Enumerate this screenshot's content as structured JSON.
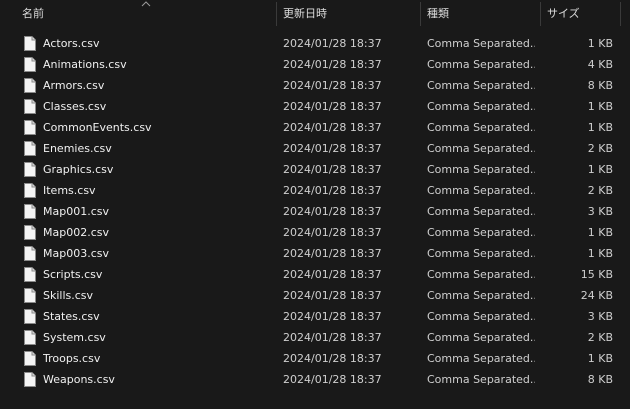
{
  "columns": {
    "name": "名前",
    "date": "更新日時",
    "type": "種類",
    "size": "サイズ"
  },
  "sort": {
    "column": "name",
    "direction": "ascending"
  },
  "files": [
    {
      "name": "Actors.csv",
      "date": "2024/01/28 18:37",
      "type": "Comma Separated...",
      "size": "1 KB"
    },
    {
      "name": "Animations.csv",
      "date": "2024/01/28 18:37",
      "type": "Comma Separated...",
      "size": "4 KB"
    },
    {
      "name": "Armors.csv",
      "date": "2024/01/28 18:37",
      "type": "Comma Separated...",
      "size": "8 KB"
    },
    {
      "name": "Classes.csv",
      "date": "2024/01/28 18:37",
      "type": "Comma Separated...",
      "size": "1 KB"
    },
    {
      "name": "CommonEvents.csv",
      "date": "2024/01/28 18:37",
      "type": "Comma Separated...",
      "size": "1 KB"
    },
    {
      "name": "Enemies.csv",
      "date": "2024/01/28 18:37",
      "type": "Comma Separated...",
      "size": "2 KB"
    },
    {
      "name": "Graphics.csv",
      "date": "2024/01/28 18:37",
      "type": "Comma Separated...",
      "size": "1 KB"
    },
    {
      "name": "Items.csv",
      "date": "2024/01/28 18:37",
      "type": "Comma Separated...",
      "size": "2 KB"
    },
    {
      "name": "Map001.csv",
      "date": "2024/01/28 18:37",
      "type": "Comma Separated...",
      "size": "3 KB"
    },
    {
      "name": "Map002.csv",
      "date": "2024/01/28 18:37",
      "type": "Comma Separated...",
      "size": "1 KB"
    },
    {
      "name": "Map003.csv",
      "date": "2024/01/28 18:37",
      "type": "Comma Separated...",
      "size": "1 KB"
    },
    {
      "name": "Scripts.csv",
      "date": "2024/01/28 18:37",
      "type": "Comma Separated...",
      "size": "15 KB"
    },
    {
      "name": "Skills.csv",
      "date": "2024/01/28 18:37",
      "type": "Comma Separated...",
      "size": "24 KB"
    },
    {
      "name": "States.csv",
      "date": "2024/01/28 18:37",
      "type": "Comma Separated...",
      "size": "3 KB"
    },
    {
      "name": "System.csv",
      "date": "2024/01/28 18:37",
      "type": "Comma Separated...",
      "size": "2 KB"
    },
    {
      "name": "Troops.csv",
      "date": "2024/01/28 18:37",
      "type": "Comma Separated...",
      "size": "1 KB"
    },
    {
      "name": "Weapons.csv",
      "date": "2024/01/28 18:37",
      "type": "Comma Separated...",
      "size": "8 KB"
    }
  ],
  "icons": {
    "file": "document-icon",
    "sort": "sort-ascending-icon"
  },
  "colors": {
    "background": "#191919",
    "text": "#f0f0f0",
    "secondary_text": "#cfcfcf",
    "separator": "#3a3a3a"
  }
}
